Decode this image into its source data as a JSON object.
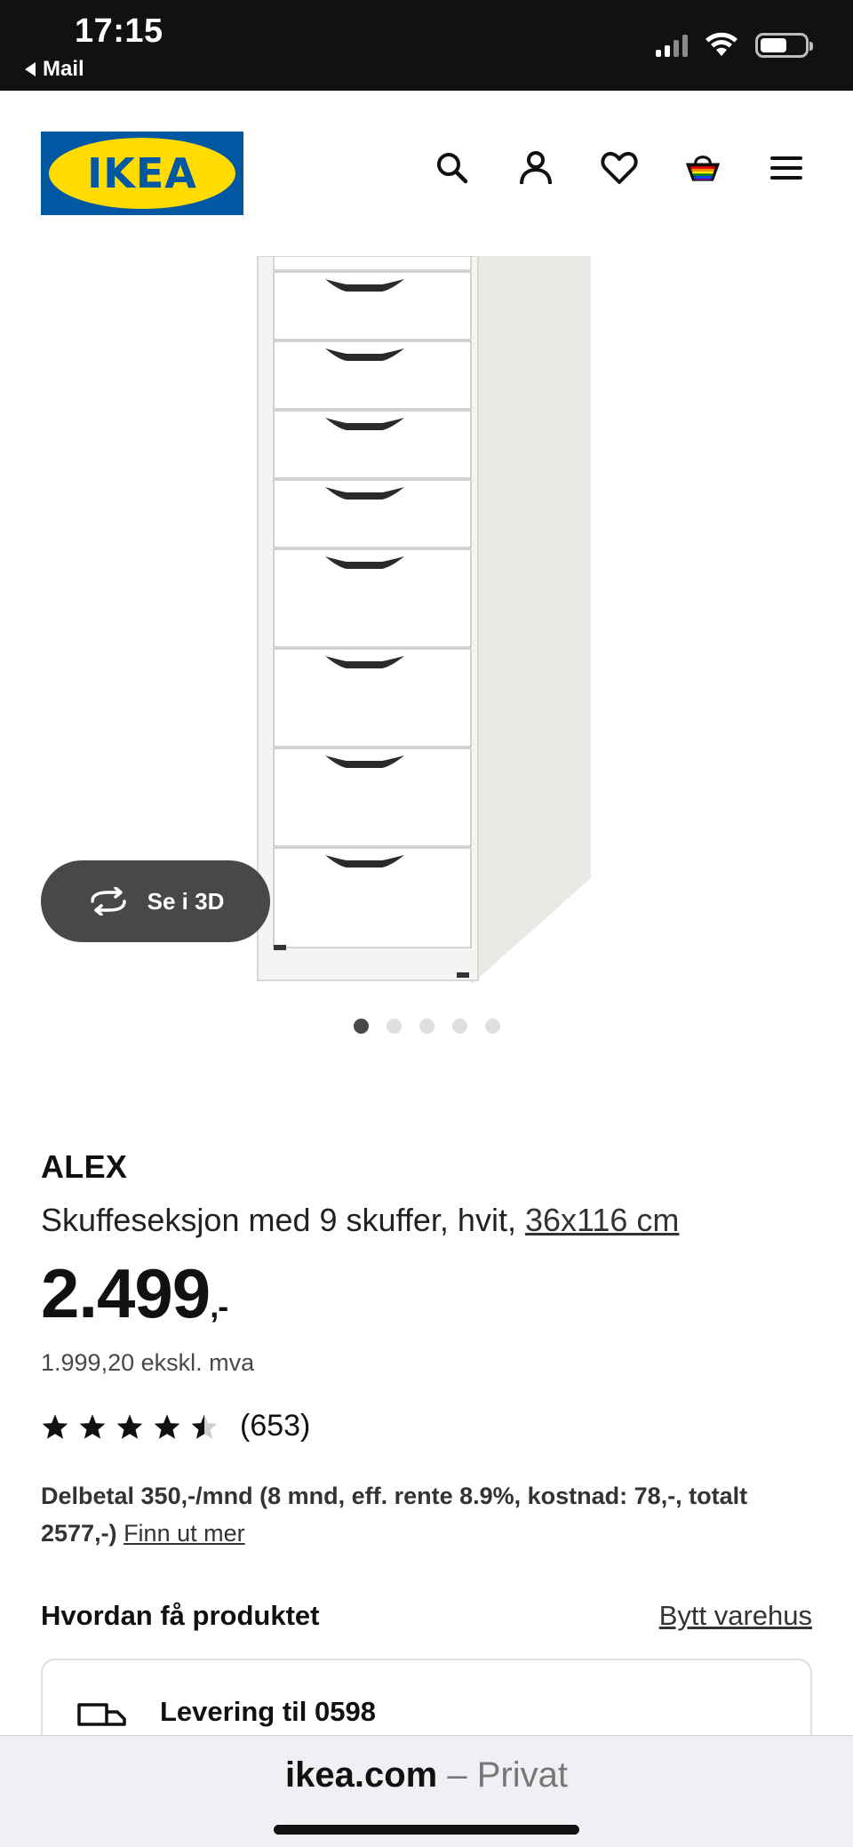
{
  "status_bar": {
    "time": "17:15",
    "back_label": "Mail",
    "icons": [
      "signal-icon",
      "wifi-icon",
      "battery-icon"
    ]
  },
  "header": {
    "logo_text": "IKEA",
    "icons": [
      "search-icon",
      "user-icon",
      "heart-icon",
      "basket-icon",
      "menu-icon"
    ],
    "basket_count": "0",
    "brand_colors": {
      "blue": "#0058a3",
      "yellow": "#ffdb00"
    }
  },
  "gallery": {
    "view_3d_label": "Se i 3D",
    "image_count": 5,
    "active_index": 0
  },
  "product": {
    "name": "ALEX",
    "description": "Skuffeseksjon med 9 skuffer, hvit, ",
    "size_link": "36x116 cm",
    "price": "2.499",
    "price_suffix": ",-",
    "price_excl_vat": "1.999,20 ekskl. mva",
    "rating": 4.5,
    "rating_count": "(653)",
    "finance_text": "Delbetal 350,-/mnd (8 mnd, eff. rente 8.9%, kostnad: 78,-, totalt 2577,-) ",
    "finance_link": "Finn ut mer"
  },
  "availability": {
    "title": "Hvordan få produktet",
    "change_store_link": "Bytt varehus",
    "delivery_label": "Levering til 0598"
  },
  "browser": {
    "domain": "ikea.com",
    "separator": " – ",
    "mode": "Privat"
  }
}
